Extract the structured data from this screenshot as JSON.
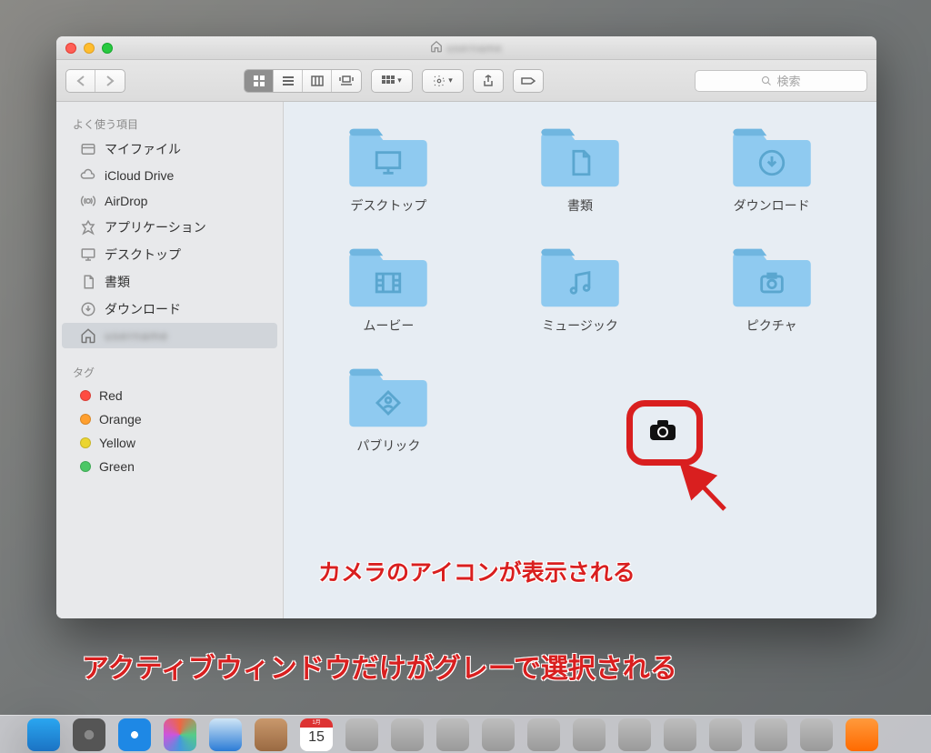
{
  "window": {
    "title_blurred": "username"
  },
  "toolbar": {
    "search_placeholder": "検索"
  },
  "sidebar": {
    "section_favorites": "よく使う項目",
    "items": [
      {
        "label": "マイファイル"
      },
      {
        "label": "iCloud Drive"
      },
      {
        "label": "AirDrop"
      },
      {
        "label": "アプリケーション"
      },
      {
        "label": "デスクトップ"
      },
      {
        "label": "書類"
      },
      {
        "label": "ダウンロード"
      },
      {
        "label": "(home)",
        "blurred": true
      }
    ],
    "section_tags": "タグ",
    "tags": [
      {
        "color": "#ff4c41",
        "label": "Red"
      },
      {
        "color": "#ff9f2e",
        "label": "Orange"
      },
      {
        "color": "#ebd530",
        "label": "Yellow"
      },
      {
        "color": "#4cc766",
        "label": "Green"
      }
    ]
  },
  "folders": [
    {
      "name": "デスクトップ",
      "icon": "desktop"
    },
    {
      "name": "書類",
      "icon": "doc"
    },
    {
      "name": "ダウンロード",
      "icon": "download"
    },
    {
      "name": "ムービー",
      "icon": "movie"
    },
    {
      "name": "ミュージック",
      "icon": "music"
    },
    {
      "name": "ピクチャ",
      "icon": "picture"
    },
    {
      "name": "パブリック",
      "icon": "public"
    }
  ],
  "annotations": {
    "camera": "カメラのアイコンが表示される",
    "active_window": "アクティブウィンドウだけがグレーで選択される"
  },
  "calendar": {
    "month": "1月",
    "day": "15"
  }
}
